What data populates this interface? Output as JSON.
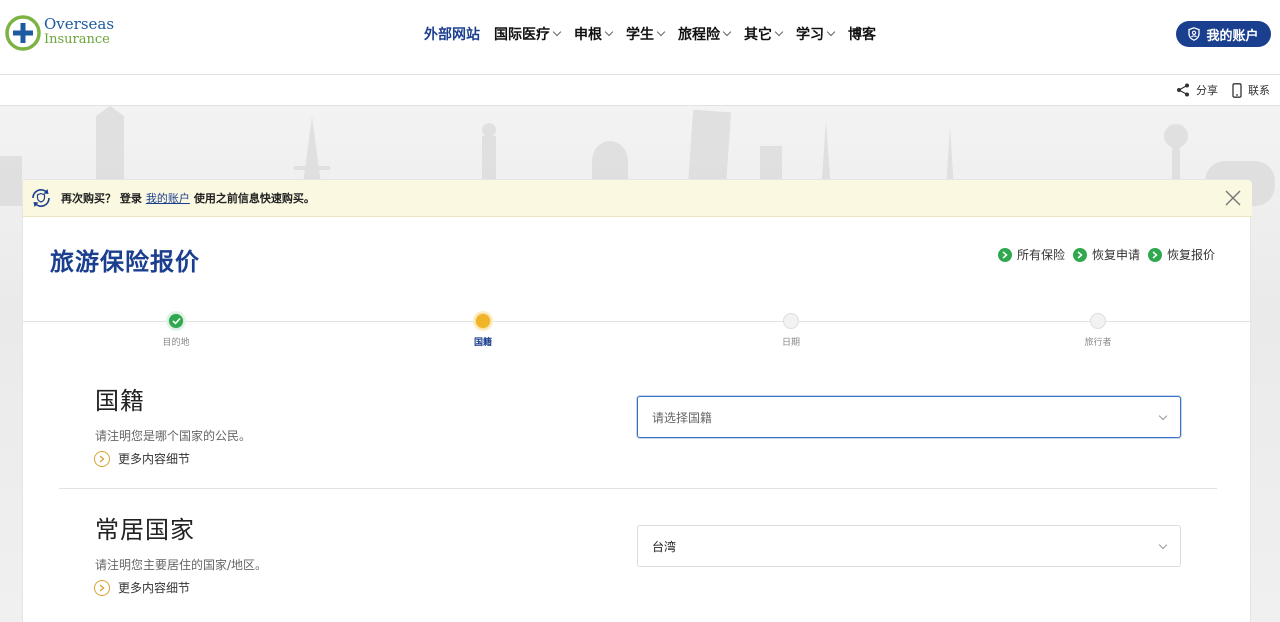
{
  "header": {
    "logo": {
      "line1": "Overseas",
      "line2": "Insurance"
    },
    "nav": [
      {
        "label": "外部网站",
        "has_dropdown": false,
        "active": true
      },
      {
        "label": "国际医疗",
        "has_dropdown": true,
        "active": false
      },
      {
        "label": "申根",
        "has_dropdown": true,
        "active": false
      },
      {
        "label": "学生",
        "has_dropdown": true,
        "active": false
      },
      {
        "label": "旅程险",
        "has_dropdown": true,
        "active": false
      },
      {
        "label": "其它",
        "has_dropdown": true,
        "active": false
      },
      {
        "label": "学习",
        "has_dropdown": true,
        "active": false
      },
      {
        "label": "博客",
        "has_dropdown": false,
        "active": false
      }
    ],
    "account_button": "我的账户"
  },
  "share_bar": {
    "share": "分享",
    "contact": "联系"
  },
  "notice": {
    "prefix": "再次购买？ 登录",
    "link": "我的账户",
    "suffix": "使用之前信息快速购买。"
  },
  "page_title": "旅游保险报价",
  "quick_links": [
    "所有保险",
    "恢复申请",
    "恢复报价"
  ],
  "steps": [
    {
      "label": "目的地",
      "state": "done"
    },
    {
      "label": "国籍",
      "state": "current"
    },
    {
      "label": "日期",
      "state": "pending"
    },
    {
      "label": "旅行者",
      "state": "pending"
    }
  ],
  "sections": {
    "nationality": {
      "title": "国籍",
      "description": "请注明您是哪个国家的公民。",
      "more": "更多内容细节",
      "select_placeholder": "请选择国籍"
    },
    "residence": {
      "title": "常居国家",
      "description": "请注明您主要居住的国家/地区。",
      "more": "更多内容细节",
      "select_value": "台湾"
    }
  },
  "colors": {
    "brand": "#1b3f8f",
    "success": "#2fa84f",
    "current": "#f0b429",
    "notice_bg": "#fbf8e1"
  }
}
